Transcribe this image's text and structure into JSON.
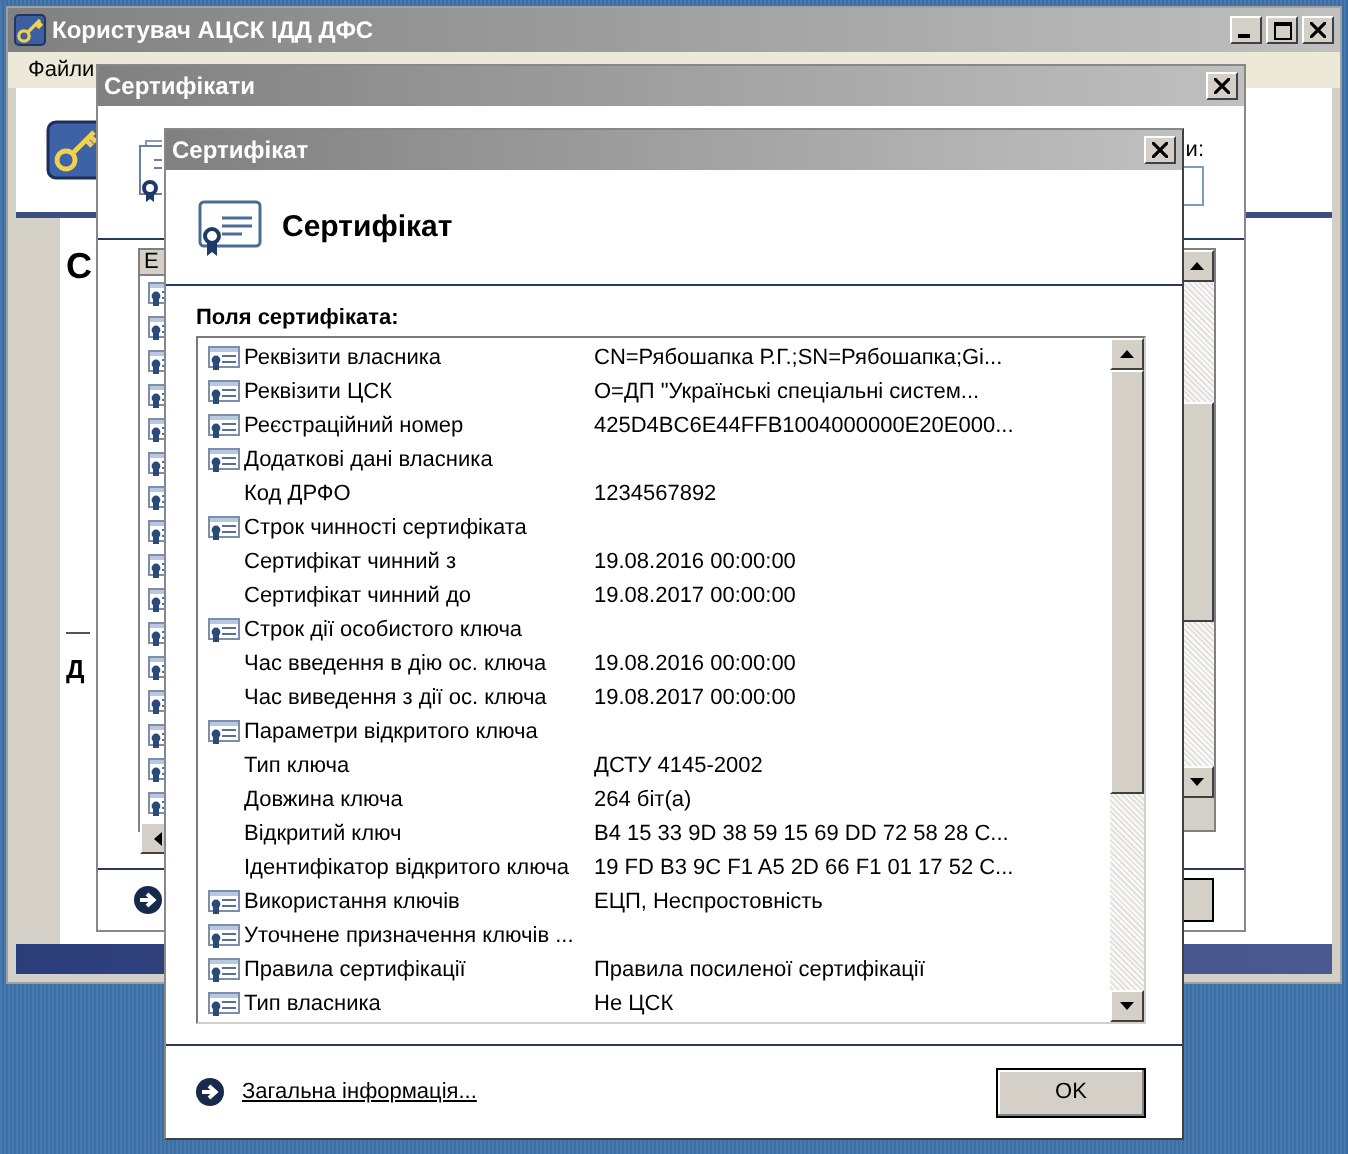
{
  "main_window": {
    "title": "Користувач АЦСК ІДД ДФС",
    "menu": [
      "Файли"
    ],
    "heading_fragment": "С",
    "section_fragment": "Д"
  },
  "list_dialog": {
    "title": "Сертифікати",
    "field_label_fragment": "и:",
    "column_fragment": "Е"
  },
  "cert_dialog": {
    "title": "Сертифікат",
    "heading": "Сертифікат",
    "fields_label": "Поля сертифіката:",
    "fields": [
      {
        "name": "Реквізити власника",
        "value": "CN=Рябошапка Р.Г.;SN=Рябошапка;Gi..."
      },
      {
        "name": "Реквізити ЦСК",
        "value": "O=ДП \"Українські спеціальні систем..."
      },
      {
        "name": "Реєстраційний номер",
        "value": "425D4BC6E44FFB1004000000E20E000..."
      },
      {
        "name": "Додаткові дані власника",
        "children": [
          {
            "name": "Код ДРФО",
            "value": "1234567892"
          }
        ]
      },
      {
        "name": "Строк чинності сертифіката",
        "children": [
          {
            "name": "Сертифікат чинний з",
            "value": "19.08.2016 00:00:00"
          },
          {
            "name": "Сертифікат чинний до",
            "value": "19.08.2017 00:00:00"
          }
        ]
      },
      {
        "name": "Строк дії особистого ключа",
        "children": [
          {
            "name": "Час введення в дію ос. ключа",
            "value": "19.08.2016 00:00:00"
          },
          {
            "name": "Час виведення з дії ос. ключа",
            "value": "19.08.2017 00:00:00"
          }
        ]
      },
      {
        "name": "Параметри відкритого ключа",
        "children": [
          {
            "name": "Тип ключа",
            "value": "ДСТУ 4145-2002"
          },
          {
            "name": "Довжина ключа",
            "value": "264 біт(а)"
          },
          {
            "name": "Відкритий ключ",
            "value": "B4 15 33 9D 38 59 15 69 DD 72 58 28 C..."
          },
          {
            "name": "Ідентифікатор відкритого ключа",
            "value": "19 FD B3 9C F1 A5 2D 66 F1 01 17 52 C..."
          }
        ]
      },
      {
        "name": "Використання ключів",
        "value": "ЕЦП, Неспростовність"
      },
      {
        "name": "Уточнене призначення ключів ..."
      },
      {
        "name": "Правила сертифікації",
        "value": "Правила посиленої сертифікації"
      },
      {
        "name": "Тип власника",
        "value": "Не ЦСК"
      }
    ],
    "link": "Загальна інформація...",
    "ok_button": "OK"
  }
}
